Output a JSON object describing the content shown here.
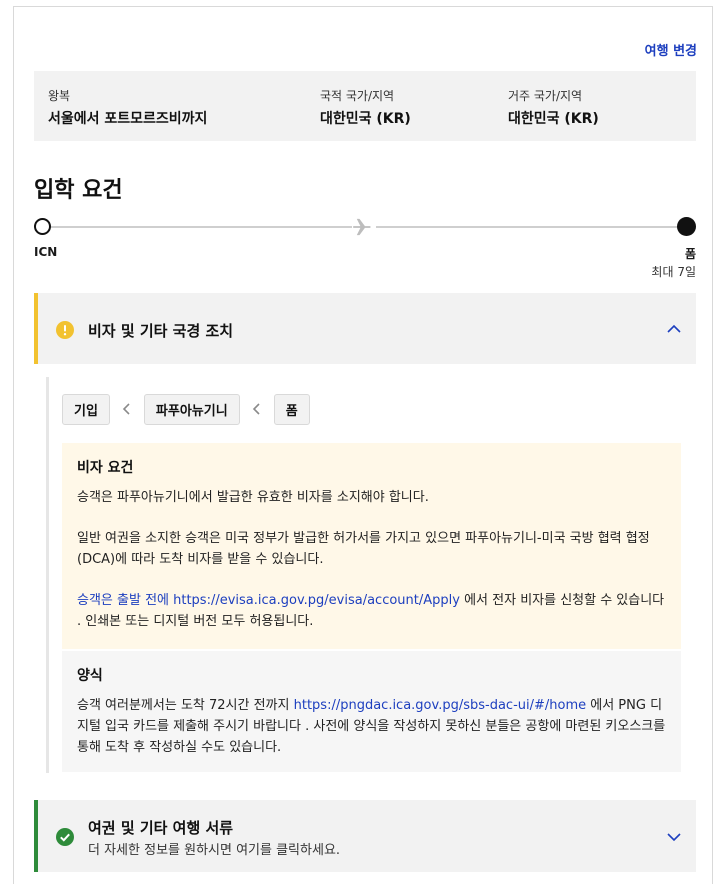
{
  "header": {
    "change_trip": "여행 변경"
  },
  "trip": {
    "type_label": "왕복",
    "route": "서울에서 포트모르즈비까지",
    "nationality_label": "국적 국가/지역",
    "nationality": "대한민국 (KR)",
    "residence_label": "거주 국가/지역",
    "residence": "대한민국 (KR)"
  },
  "requirements": {
    "title": "입학 요건",
    "origin": "ICN",
    "destination": "폼",
    "stay": "최대 7일"
  },
  "visa_section": {
    "title": "비자 및 기타 국경 조치",
    "breadcrumbs": [
      "기입",
      "파푸아뉴기니",
      "폼"
    ],
    "visa_req": {
      "title": "비자 요건",
      "p1": "승객은 파푸아뉴기니에서 발급한 유효한 비자를 소지해야 합니다.",
      "p2": "일반 여권을 소지한 승객은 미국 정부가 발급한 허가서를 가지고 있으면 파푸아뉴기니-미국 국방 협력 협정(DCA)에 따라 도착 비자를 받을 수 있습니다.",
      "p3_link": "승객은 출발 전에 https://evisa.ica.gov.pg/evisa/account/Apply",
      "p3_rest": " 에서 전자 비자를 신청할 수 있습니다 . 인쇄본 또는 디지털 버전 모두 허용됩니다."
    },
    "form": {
      "title": "양식",
      "pre": "승객 여러분께서는 도착 72시간 전까지 ",
      "link": "https://pngdac.ica.gov.pg/sbs-dac-ui/#/home",
      "post": " 에서 PNG 디지털 입국 카드를 제출해 주시기 바랍니다 . 사전에 양식을 작성하지 못하신 분들은 공항에 마련된 키오스크를 통해 도착 후 작성하실 수도 있습니다."
    }
  },
  "passport_section": {
    "title": "여권 및 기타 여행 서류",
    "subtitle": "더 자세한 정보를 원하시면 여기를 클릭하세요."
  },
  "colors": {
    "link": "#1d3fbf",
    "warning": "#f2c230",
    "success": "#2e8b3a",
    "notice_bg": "#fff8e8"
  },
  "icons": [
    "plane-icon",
    "warning-icon",
    "chevron-up-icon",
    "chevron-left-icon",
    "check-circle-icon",
    "chevron-down-icon"
  ]
}
